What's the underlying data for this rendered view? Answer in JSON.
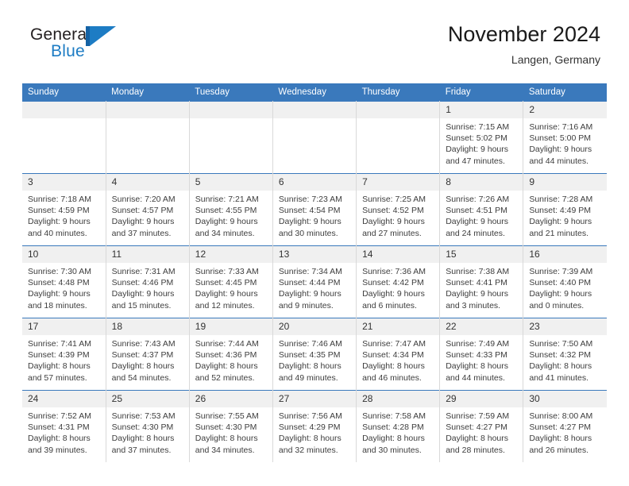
{
  "logo": {
    "word1": "General",
    "word2": "Blue",
    "mark": "flag-triangle-icon",
    "colors": {
      "bar": "#1462a5",
      "triangle": "#1d7cc4",
      "text_blue": "#1d7cc4",
      "text_dark": "#231f20"
    }
  },
  "header": {
    "title": "November 2024",
    "location": "Langen, Germany"
  },
  "theme": {
    "header_blue": "#3a79bc",
    "daynum_band": "#f0f0f0",
    "cell_border": "#d9d9d9"
  },
  "weekday_headers": [
    "Sunday",
    "Monday",
    "Tuesday",
    "Wednesday",
    "Thursday",
    "Friday",
    "Saturday"
  ],
  "labels": {
    "sunrise_prefix": "Sunrise: ",
    "sunset_prefix": "Sunset: ",
    "daylight_prefix": "Daylight: "
  },
  "weeks": [
    [
      {
        "day": "",
        "sunrise": "",
        "sunset": "",
        "daylight_line1": "",
        "daylight_line2": "",
        "empty": true
      },
      {
        "day": "",
        "sunrise": "",
        "sunset": "",
        "daylight_line1": "",
        "daylight_line2": "",
        "empty": true
      },
      {
        "day": "",
        "sunrise": "",
        "sunset": "",
        "daylight_line1": "",
        "daylight_line2": "",
        "empty": true
      },
      {
        "day": "",
        "sunrise": "",
        "sunset": "",
        "daylight_line1": "",
        "daylight_line2": "",
        "empty": true
      },
      {
        "day": "",
        "sunrise": "",
        "sunset": "",
        "daylight_line1": "",
        "daylight_line2": "",
        "empty": true
      },
      {
        "day": "1",
        "sunrise": "Sunrise: 7:15 AM",
        "sunset": "Sunset: 5:02 PM",
        "daylight_line1": "Daylight: 9 hours",
        "daylight_line2": "and 47 minutes.",
        "empty": false
      },
      {
        "day": "2",
        "sunrise": "Sunrise: 7:16 AM",
        "sunset": "Sunset: 5:00 PM",
        "daylight_line1": "Daylight: 9 hours",
        "daylight_line2": "and 44 minutes.",
        "empty": false
      }
    ],
    [
      {
        "day": "3",
        "sunrise": "Sunrise: 7:18 AM",
        "sunset": "Sunset: 4:59 PM",
        "daylight_line1": "Daylight: 9 hours",
        "daylight_line2": "and 40 minutes.",
        "empty": false
      },
      {
        "day": "4",
        "sunrise": "Sunrise: 7:20 AM",
        "sunset": "Sunset: 4:57 PM",
        "daylight_line1": "Daylight: 9 hours",
        "daylight_line2": "and 37 minutes.",
        "empty": false
      },
      {
        "day": "5",
        "sunrise": "Sunrise: 7:21 AM",
        "sunset": "Sunset: 4:55 PM",
        "daylight_line1": "Daylight: 9 hours",
        "daylight_line2": "and 34 minutes.",
        "empty": false
      },
      {
        "day": "6",
        "sunrise": "Sunrise: 7:23 AM",
        "sunset": "Sunset: 4:54 PM",
        "daylight_line1": "Daylight: 9 hours",
        "daylight_line2": "and 30 minutes.",
        "empty": false
      },
      {
        "day": "7",
        "sunrise": "Sunrise: 7:25 AM",
        "sunset": "Sunset: 4:52 PM",
        "daylight_line1": "Daylight: 9 hours",
        "daylight_line2": "and 27 minutes.",
        "empty": false
      },
      {
        "day": "8",
        "sunrise": "Sunrise: 7:26 AM",
        "sunset": "Sunset: 4:51 PM",
        "daylight_line1": "Daylight: 9 hours",
        "daylight_line2": "and 24 minutes.",
        "empty": false
      },
      {
        "day": "9",
        "sunrise": "Sunrise: 7:28 AM",
        "sunset": "Sunset: 4:49 PM",
        "daylight_line1": "Daylight: 9 hours",
        "daylight_line2": "and 21 minutes.",
        "empty": false
      }
    ],
    [
      {
        "day": "10",
        "sunrise": "Sunrise: 7:30 AM",
        "sunset": "Sunset: 4:48 PM",
        "daylight_line1": "Daylight: 9 hours",
        "daylight_line2": "and 18 minutes.",
        "empty": false
      },
      {
        "day": "11",
        "sunrise": "Sunrise: 7:31 AM",
        "sunset": "Sunset: 4:46 PM",
        "daylight_line1": "Daylight: 9 hours",
        "daylight_line2": "and 15 minutes.",
        "empty": false
      },
      {
        "day": "12",
        "sunrise": "Sunrise: 7:33 AM",
        "sunset": "Sunset: 4:45 PM",
        "daylight_line1": "Daylight: 9 hours",
        "daylight_line2": "and 12 minutes.",
        "empty": false
      },
      {
        "day": "13",
        "sunrise": "Sunrise: 7:34 AM",
        "sunset": "Sunset: 4:44 PM",
        "daylight_line1": "Daylight: 9 hours",
        "daylight_line2": "and 9 minutes.",
        "empty": false
      },
      {
        "day": "14",
        "sunrise": "Sunrise: 7:36 AM",
        "sunset": "Sunset: 4:42 PM",
        "daylight_line1": "Daylight: 9 hours",
        "daylight_line2": "and 6 minutes.",
        "empty": false
      },
      {
        "day": "15",
        "sunrise": "Sunrise: 7:38 AM",
        "sunset": "Sunset: 4:41 PM",
        "daylight_line1": "Daylight: 9 hours",
        "daylight_line2": "and 3 minutes.",
        "empty": false
      },
      {
        "day": "16",
        "sunrise": "Sunrise: 7:39 AM",
        "sunset": "Sunset: 4:40 PM",
        "daylight_line1": "Daylight: 9 hours",
        "daylight_line2": "and 0 minutes.",
        "empty": false
      }
    ],
    [
      {
        "day": "17",
        "sunrise": "Sunrise: 7:41 AM",
        "sunset": "Sunset: 4:39 PM",
        "daylight_line1": "Daylight: 8 hours",
        "daylight_line2": "and 57 minutes.",
        "empty": false
      },
      {
        "day": "18",
        "sunrise": "Sunrise: 7:43 AM",
        "sunset": "Sunset: 4:37 PM",
        "daylight_line1": "Daylight: 8 hours",
        "daylight_line2": "and 54 minutes.",
        "empty": false
      },
      {
        "day": "19",
        "sunrise": "Sunrise: 7:44 AM",
        "sunset": "Sunset: 4:36 PM",
        "daylight_line1": "Daylight: 8 hours",
        "daylight_line2": "and 52 minutes.",
        "empty": false
      },
      {
        "day": "20",
        "sunrise": "Sunrise: 7:46 AM",
        "sunset": "Sunset: 4:35 PM",
        "daylight_line1": "Daylight: 8 hours",
        "daylight_line2": "and 49 minutes.",
        "empty": false
      },
      {
        "day": "21",
        "sunrise": "Sunrise: 7:47 AM",
        "sunset": "Sunset: 4:34 PM",
        "daylight_line1": "Daylight: 8 hours",
        "daylight_line2": "and 46 minutes.",
        "empty": false
      },
      {
        "day": "22",
        "sunrise": "Sunrise: 7:49 AM",
        "sunset": "Sunset: 4:33 PM",
        "daylight_line1": "Daylight: 8 hours",
        "daylight_line2": "and 44 minutes.",
        "empty": false
      },
      {
        "day": "23",
        "sunrise": "Sunrise: 7:50 AM",
        "sunset": "Sunset: 4:32 PM",
        "daylight_line1": "Daylight: 8 hours",
        "daylight_line2": "and 41 minutes.",
        "empty": false
      }
    ],
    [
      {
        "day": "24",
        "sunrise": "Sunrise: 7:52 AM",
        "sunset": "Sunset: 4:31 PM",
        "daylight_line1": "Daylight: 8 hours",
        "daylight_line2": "and 39 minutes.",
        "empty": false
      },
      {
        "day": "25",
        "sunrise": "Sunrise: 7:53 AM",
        "sunset": "Sunset: 4:30 PM",
        "daylight_line1": "Daylight: 8 hours",
        "daylight_line2": "and 37 minutes.",
        "empty": false
      },
      {
        "day": "26",
        "sunrise": "Sunrise: 7:55 AM",
        "sunset": "Sunset: 4:30 PM",
        "daylight_line1": "Daylight: 8 hours",
        "daylight_line2": "and 34 minutes.",
        "empty": false
      },
      {
        "day": "27",
        "sunrise": "Sunrise: 7:56 AM",
        "sunset": "Sunset: 4:29 PM",
        "daylight_line1": "Daylight: 8 hours",
        "daylight_line2": "and 32 minutes.",
        "empty": false
      },
      {
        "day": "28",
        "sunrise": "Sunrise: 7:58 AM",
        "sunset": "Sunset: 4:28 PM",
        "daylight_line1": "Daylight: 8 hours",
        "daylight_line2": "and 30 minutes.",
        "empty": false
      },
      {
        "day": "29",
        "sunrise": "Sunrise: 7:59 AM",
        "sunset": "Sunset: 4:27 PM",
        "daylight_line1": "Daylight: 8 hours",
        "daylight_line2": "and 28 minutes.",
        "empty": false
      },
      {
        "day": "30",
        "sunrise": "Sunrise: 8:00 AM",
        "sunset": "Sunset: 4:27 PM",
        "daylight_line1": "Daylight: 8 hours",
        "daylight_line2": "and 26 minutes.",
        "empty": false
      }
    ]
  ]
}
